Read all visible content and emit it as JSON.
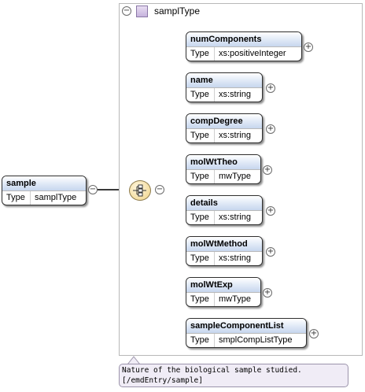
{
  "complex_type": {
    "name": "samplType"
  },
  "root": {
    "name": "sample",
    "type_key": "Type",
    "type_value": "samplType"
  },
  "elements": [
    {
      "name": "numComponents",
      "type_key": "Type",
      "type_value": "xs:positiveInteger"
    },
    {
      "name": "name",
      "type_key": "Type",
      "type_value": "xs:string"
    },
    {
      "name": "compDegree",
      "type_key": "Type",
      "type_value": "xs:string"
    },
    {
      "name": "molWtTheo",
      "type_key": "Type",
      "type_value": "mwType"
    },
    {
      "name": "details",
      "type_key": "Type",
      "type_value": "xs:string"
    },
    {
      "name": "molWtMethod",
      "type_key": "Type",
      "type_value": "xs:string"
    },
    {
      "name": "molWtExp",
      "type_key": "Type",
      "type_value": "mwType"
    },
    {
      "name": "sampleComponentList",
      "type_key": "Type",
      "type_value": "smplCompListType"
    }
  ],
  "annotation": {
    "line1": "Nature of the biological sample studied.",
    "line2": "[/emdEntry/sample]"
  },
  "symbols": {
    "collapse": "−",
    "expand": "+"
  },
  "icons": [
    "collapse-icon",
    "complex-type-icon",
    "sequence-icon",
    "expand-icon"
  ]
}
